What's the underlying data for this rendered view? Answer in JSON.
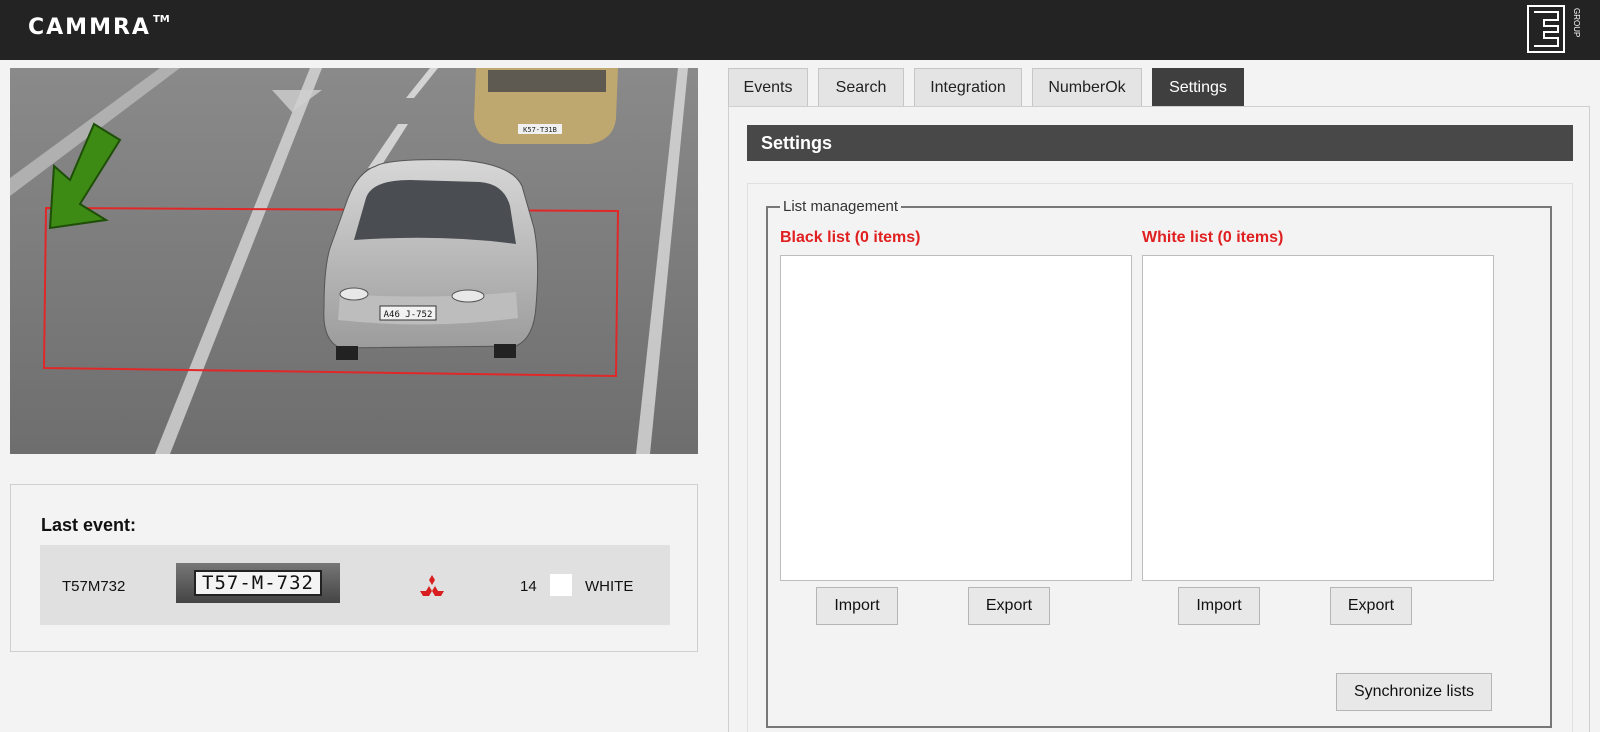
{
  "brand": {
    "name": "CAMMRA",
    "trademark": "TM"
  },
  "group_logo": {
    "text": "GROUP"
  },
  "tabs": [
    {
      "label": "Events",
      "active": false
    },
    {
      "label": "Search",
      "active": false
    },
    {
      "label": "Integration",
      "active": false
    },
    {
      "label": "NumberOk",
      "active": false
    },
    {
      "label": "Settings",
      "active": true
    }
  ],
  "camera": {
    "front_plate": "A46 J-752",
    "rear_plate": "K57-T31B"
  },
  "last_event": {
    "title": "Last event:",
    "plate_number": "T57M732",
    "plate_image_text": "T57-M-732",
    "make_icon": "mitsubishi-logo-icon",
    "count": "14",
    "color_name": "WHITE",
    "color_hex": "#ffffff"
  },
  "settings": {
    "title": "Settings",
    "list_management": {
      "legend": "List management",
      "black_list": {
        "title": "Black list (0 items)",
        "import_label": "Import",
        "export_label": "Export"
      },
      "white_list": {
        "title": "White list (0 items)",
        "import_label": "Import",
        "export_label": "Export"
      },
      "sync_label": "Synchronize lists"
    }
  },
  "colors": {
    "accent_red": "#e02020",
    "topbar": "#232323",
    "active_tab": "#3f3f3f",
    "section_header": "#484848"
  }
}
